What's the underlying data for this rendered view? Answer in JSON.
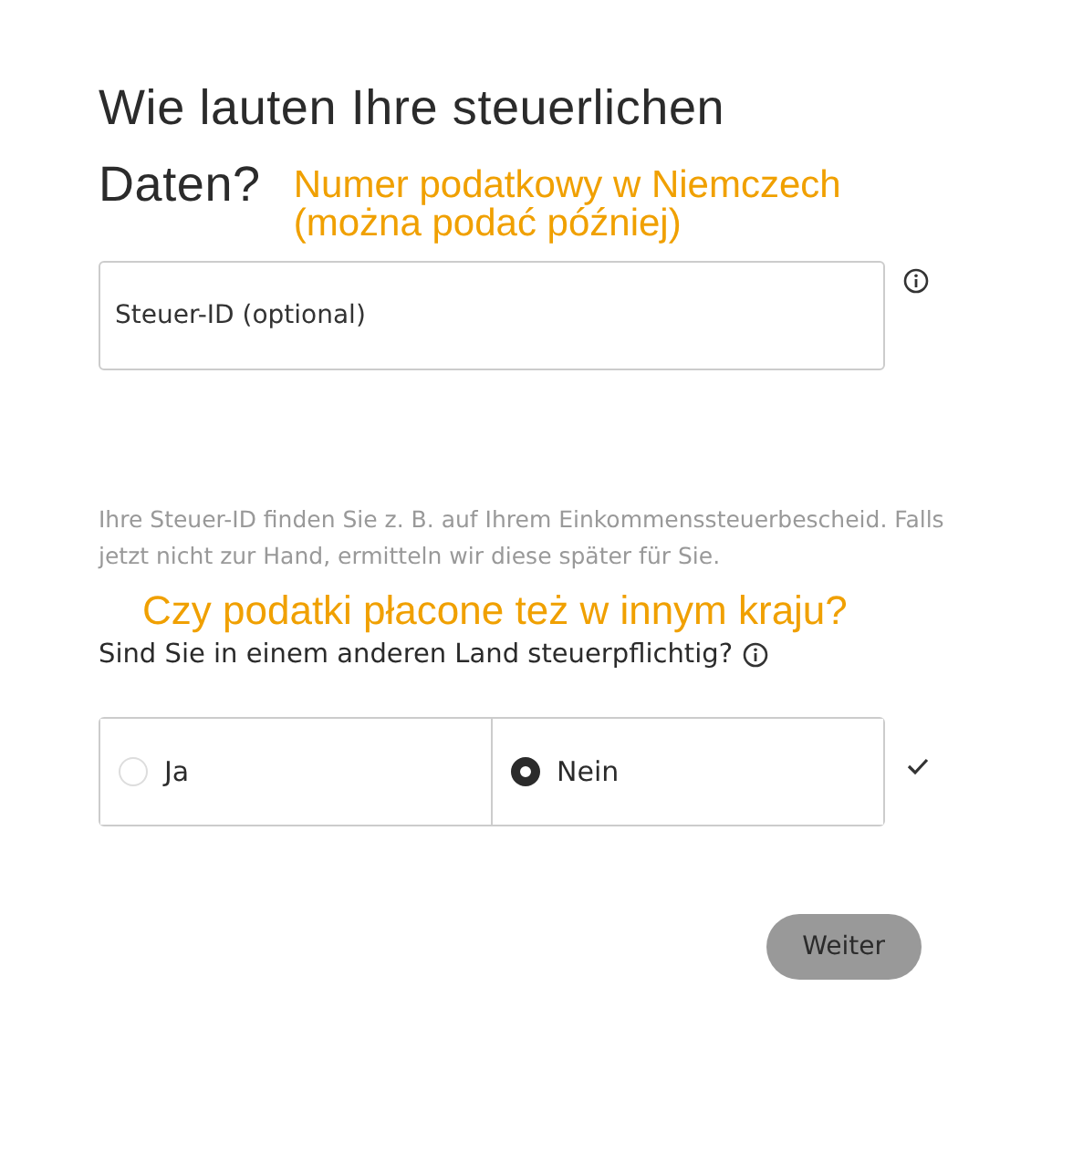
{
  "title_lines": [
    "Wie lauten Ihre steuerlichen",
    "Daten?"
  ],
  "annotations": [
    {
      "text": "Numer podatkowy w Niemczech (można podać później)"
    },
    {
      "text": "Czy podatki płacone też w innym kraju?"
    }
  ],
  "tax_id_field": {
    "placeholder": "Steuer-ID (optional)"
  },
  "help_text": "Ihre Steuer-ID finden Sie z. B. auf Ihrem Einkommenssteuerbescheid. Falls jetzt nicht zur Hand, ermitteln wir diese später für Sie.",
  "question": "Sind Sie in einem anderen Land steuerpflichtig?",
  "options": [
    {
      "label": "Ja",
      "selected": false
    },
    {
      "label": "Nein",
      "selected": true
    }
  ],
  "answered": true,
  "button": "Weiter"
}
